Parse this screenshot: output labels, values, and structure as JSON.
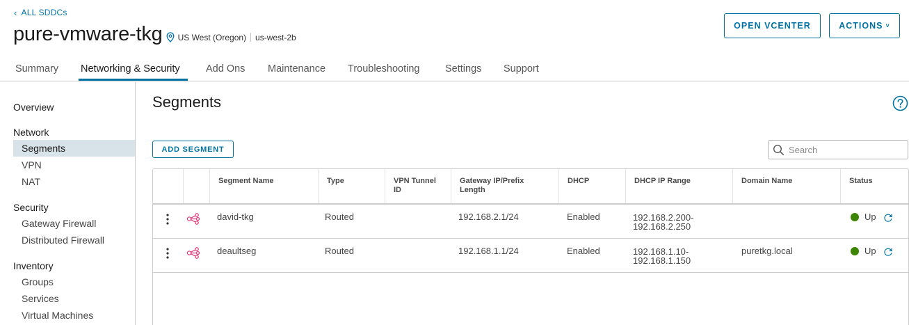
{
  "header": {
    "back_label": "ALL SDDCs",
    "title": "pure-vmware-tkg",
    "region": "US West (Oregon)",
    "zone": "us-west-2b",
    "open_vcenter_label": "OPEN VCENTER",
    "actions_label": "ACTIONS"
  },
  "tabs": [
    {
      "label": "Summary"
    },
    {
      "label": "Networking & Security",
      "active": true
    },
    {
      "label": "Add Ons"
    },
    {
      "label": "Maintenance"
    },
    {
      "label": "Troubleshooting"
    },
    {
      "label": "Settings"
    },
    {
      "label": "Support"
    }
  ],
  "sidebar": {
    "overview": "Overview",
    "network": {
      "heading": "Network",
      "items": [
        "Segments",
        "VPN",
        "NAT"
      ]
    },
    "security": {
      "heading": "Security",
      "items": [
        "Gateway Firewall",
        "Distributed Firewall"
      ]
    },
    "inventory": {
      "heading": "Inventory",
      "items": [
        "Groups",
        "Services",
        "Virtual Machines"
      ]
    },
    "active_item": "Segments"
  },
  "main": {
    "title": "Segments",
    "add_segment_label": "ADD SEGMENT",
    "search_placeholder": "Search"
  },
  "table": {
    "columns": [
      "Segment Name",
      "Type",
      "VPN Tunnel ID",
      "Gateway IP/Prefix Length",
      "DHCP",
      "DHCP IP Range",
      "Domain Name",
      "Status"
    ],
    "rows": [
      {
        "name": "david-tkg",
        "type": "Routed",
        "vpn": "",
        "gateway": "192.168.2.1/24",
        "dhcp": "Enabled",
        "range_start": "192.168.2.200-",
        "range_end": "192.168.2.250",
        "domain": "",
        "status": "Up"
      },
      {
        "name": "deaultseg",
        "type": "Routed",
        "vpn": "",
        "gateway": "192.168.1.1/24",
        "dhcp": "Enabled",
        "range_start": "192.168.1.10-",
        "range_end": "192.168.1.150",
        "domain": "puretkg.local",
        "status": "Up"
      }
    ]
  },
  "colors": {
    "accent": "#0072a3",
    "status_up": "#3c8500",
    "segment_icon": "#e0417f",
    "active_sidebar_bg": "#d8e3e9"
  }
}
